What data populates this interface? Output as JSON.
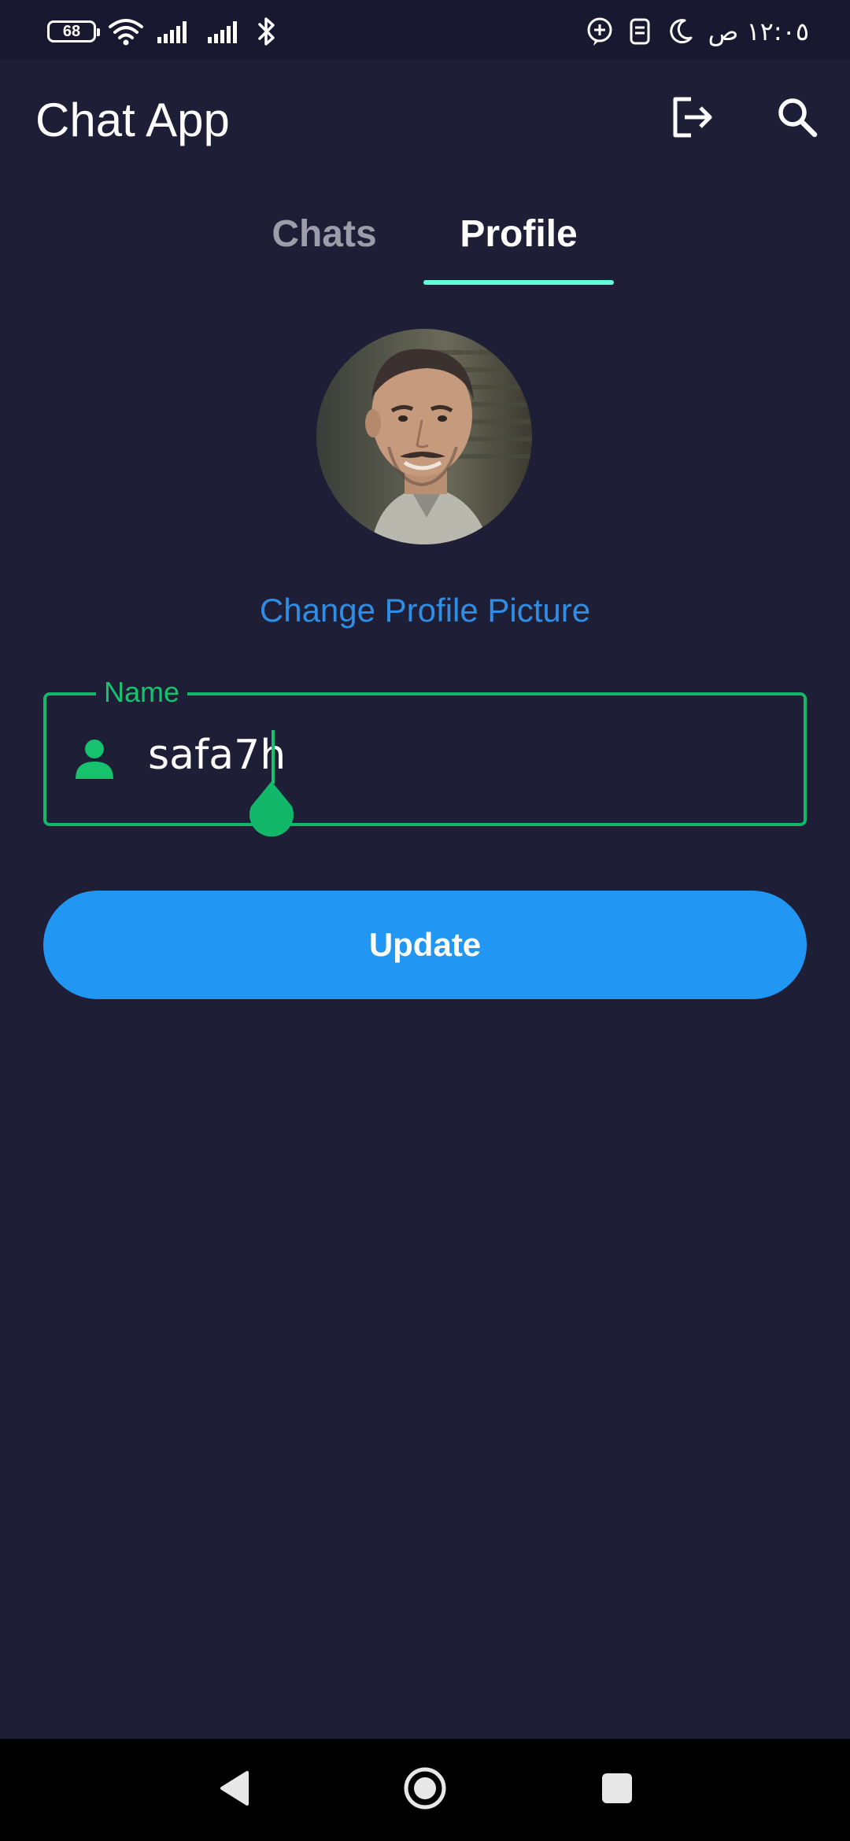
{
  "status_bar": {
    "battery": "68",
    "time": "١٢:٠٥ ص",
    "icons": [
      "wifi-icon",
      "signal-icon",
      "signal-icon",
      "bluetooth-icon",
      "add-message-icon",
      "sim-icon",
      "moon-icon"
    ]
  },
  "app_bar": {
    "title": "Chat App",
    "actions": [
      "logout-icon",
      "search-icon"
    ]
  },
  "tabs": [
    {
      "label": "Chats",
      "selected": false
    },
    {
      "label": "Profile",
      "selected": true
    }
  ],
  "profile": {
    "change_picture_label": "Change Profile Picture",
    "name_field": {
      "label": "Name",
      "value": "safa7h",
      "icon": "person-icon"
    },
    "update_label": "Update"
  },
  "nav_bar": {
    "buttons": [
      "back-icon",
      "home-icon",
      "recents-icon"
    ]
  },
  "colors": {
    "background": "#1e1e36",
    "status_bar": "#181830",
    "accent_green": "#12b76a",
    "tab_indicator": "#64ffda",
    "link_blue": "#2f8de4",
    "button_blue": "#2196f3"
  }
}
